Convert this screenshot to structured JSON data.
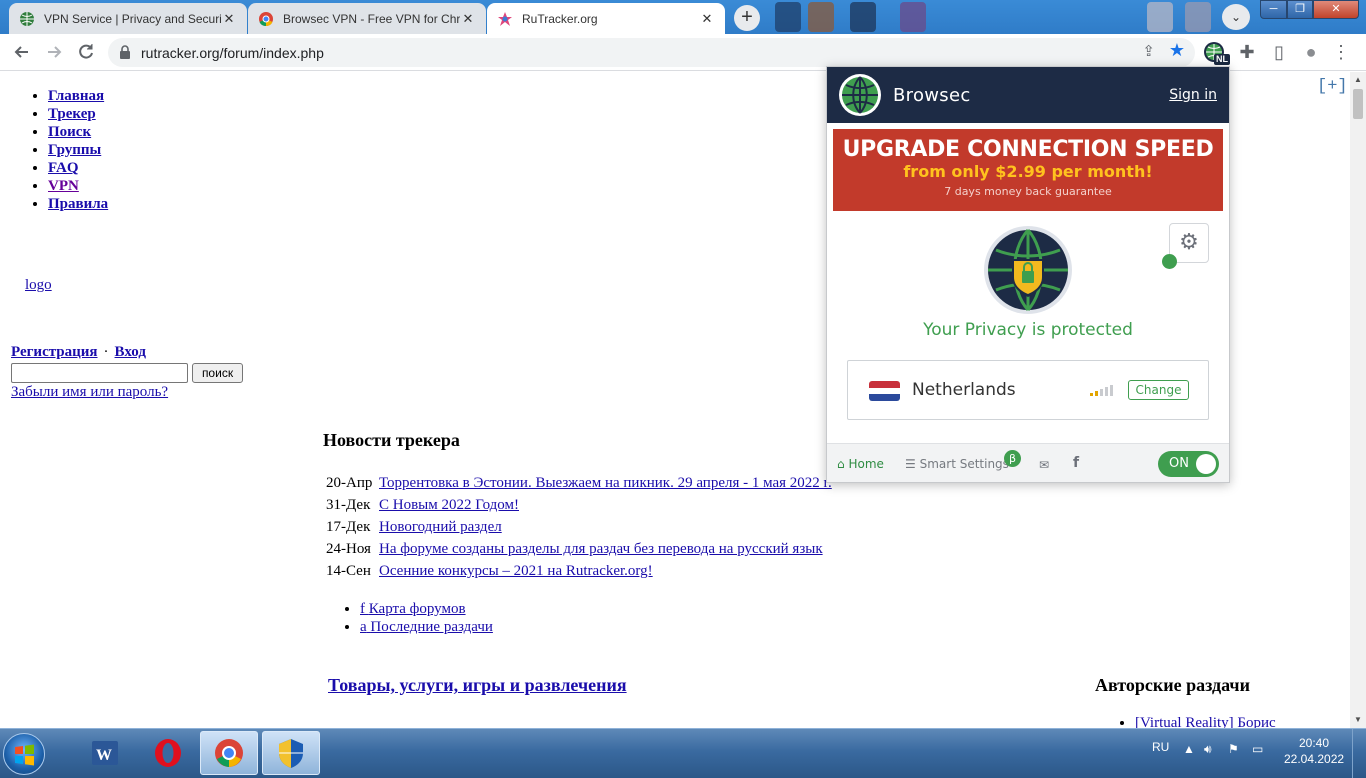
{
  "window": {
    "min_label": "─",
    "max_label": "❐",
    "close_label": "✕"
  },
  "tabs": [
    {
      "title": "VPN Service | Privacy and Securit",
      "active": false
    },
    {
      "title": "Browsec VPN - Free VPN for Chro",
      "active": false
    },
    {
      "title": "RuTracker.org",
      "active": true
    }
  ],
  "tab_close": "✕",
  "newtab_label": "+",
  "profile_bubble": "⌄",
  "toolbar": {
    "back_icon": "arrow-left",
    "forward_icon": "arrow-right",
    "reload_icon": "reload",
    "url": "rutracker.org/forum/index.php",
    "ext_badge": "NL",
    "puzzle": "✚",
    "sidepanel": "▯",
    "profile": "●",
    "menu": "⋮"
  },
  "page": {
    "nav": [
      {
        "label": "Главная"
      },
      {
        "label": "Трекер"
      },
      {
        "label": "Поиск"
      },
      {
        "label": "Группы"
      },
      {
        "label": "FAQ"
      },
      {
        "label": "VPN"
      },
      {
        "label": "Правила"
      }
    ],
    "logo_alt": "logo",
    "register": "Регистрация",
    "auth_sep": "·",
    "login": "Вход",
    "search_value": "",
    "search_button": "поиск",
    "forgot": "Забыли имя или пароль?",
    "news_title": "Новости трекера",
    "news": [
      {
        "date": "20-Апр",
        "text": "Торрентовка в Эстонии. Выезжаем на пикник. 29 апреля - 1 мая 2022 г."
      },
      {
        "date": "31-Дек",
        "text": "С Новым 2022 Годом!"
      },
      {
        "date": "17-Дек",
        "text": "Новогодний раздел"
      },
      {
        "date": "24-Ноя",
        "text": "На форуме созданы разделы для раздач без перевода на русский язык"
      },
      {
        "date": "14-Сен",
        "text": "Осенние конкурсы – 2021 на Rutracker.org!"
      }
    ],
    "quick_links": [
      {
        "alt": "f",
        "label": "Карта форумов"
      },
      {
        "alt": "a",
        "label": "Последние раздачи"
      }
    ],
    "goods_title": "Товары, услуги, игры и развлечения",
    "author_title": "Авторские раздачи",
    "author_items": [
      {
        "label": "[Virtual Reality] Борис"
      }
    ],
    "plus_label": "[+]"
  },
  "browsec": {
    "brand": "Browsec",
    "sign_in": "Sign in",
    "upgrade_line1": "UPGRADE CONNECTION SPEED",
    "upgrade_line2": "from only $2.99 per month!",
    "upgrade_line3": "7 days money back guarantee",
    "status": "Your Privacy is protected",
    "country": "Netherlands",
    "change": "Change",
    "signal_level": 0.4,
    "footer": {
      "home": "Home",
      "smart_settings": "Smart Settings",
      "beta": "β",
      "toggle": "ON"
    },
    "colors": {
      "header": "#1d2b45",
      "promo": "#c23a2b",
      "accent": "#3f9e4f",
      "promo_highlight": "#ffc21e"
    }
  },
  "taskbar": {
    "lang": "RU",
    "time": "20:40",
    "date": "22.04.2022",
    "apps": [
      {
        "name": "word-icon"
      },
      {
        "name": "opera-icon"
      },
      {
        "name": "chrome-icon"
      },
      {
        "name": "uac-shield-icon"
      }
    ]
  }
}
